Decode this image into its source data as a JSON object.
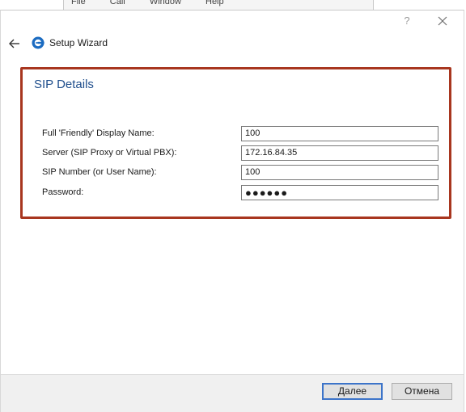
{
  "background_app": {
    "menu": [
      "File",
      "Call",
      "Window",
      "Help"
    ]
  },
  "titlebar": {
    "help_label": "?",
    "close_icon": "close-icon"
  },
  "header": {
    "back_icon": "arrow-left-icon",
    "logo_icon": "app-logo-icon",
    "title": "Setup Wizard"
  },
  "sip_details": {
    "title": "SIP Details",
    "fields": [
      {
        "label": "Full 'Friendly' Display Name:",
        "value": "100"
      },
      {
        "label": "Server (SIP Proxy or Virtual PBX):",
        "value": "172.16.84.35"
      },
      {
        "label": "SIP Number (or User Name):",
        "value": "100"
      },
      {
        "label": "Password:",
        "value": "●●●●●●"
      }
    ],
    "highlight_color": "#a8361f",
    "title_color": "#1f4e8c"
  },
  "footer": {
    "next_label": "Далее",
    "cancel_label": "Отмена",
    "accent_color": "#3c74c9"
  }
}
